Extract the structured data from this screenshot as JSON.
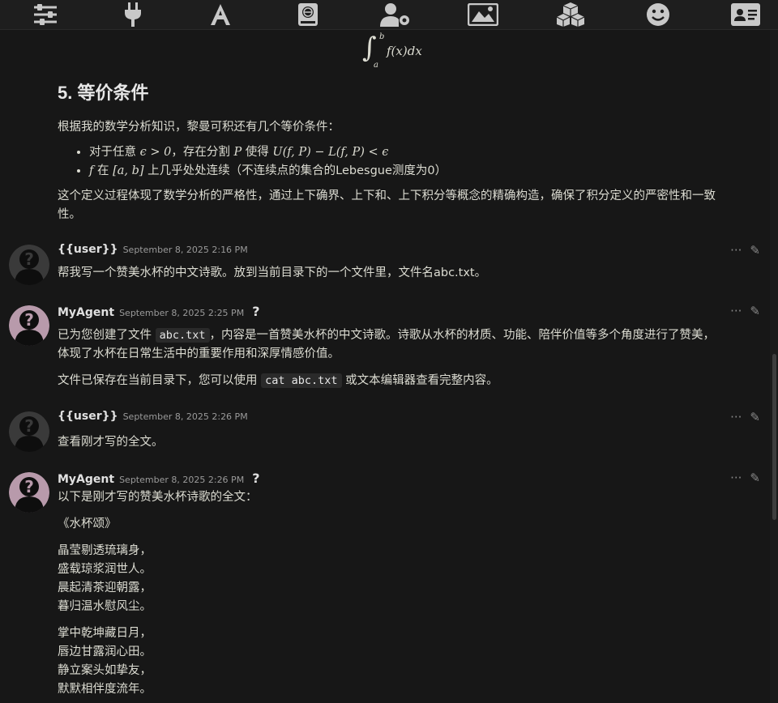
{
  "toolbar": {
    "icons": [
      "sliders-icon",
      "plug-icon",
      "font-icon",
      "book-atlas-icon",
      "user-gear-icon",
      "image-icon",
      "cubes-icon",
      "smile-icon",
      "id-card-icon"
    ]
  },
  "math_block": {
    "integral_upper": "b",
    "integral_lower": "a",
    "integrand": "f(x)dx"
  },
  "section": {
    "heading": "5. 等价条件",
    "intro": "根据我的数学分析知识，黎曼可积还有几个等价条件：",
    "cond1_prefix": "对于任意 ",
    "cond1_math1": "ϵ > 0",
    "cond1_mid": "，存在分割 ",
    "cond1_math2": "P",
    "cond1_mid2": " 使得 ",
    "cond1_math3": "U(f, P) − L(f, P) < ϵ",
    "cond2_math1": "f",
    "cond2_mid": " 在 ",
    "cond2_math2": "[a, b]",
    "cond2_text": " 上几乎处处连续（不连续点的集合的Lebesgue测度为0）",
    "conclusion": "这个定义过程体现了数学分析的严格性，通过上下确界、上下和、上下积分等概念的精确构造，确保了积分定义的严密性和一致性。"
  },
  "messages": [
    {
      "sender": "{{user}}",
      "time": "September 8, 2025 2:16 PM",
      "text": "帮我写一个赞美水杯的中文诗歌。放到当前目录下的一个文件里，文件名abc.txt。"
    },
    {
      "sender": "MyAgent",
      "time": "September 8, 2025 2:25 PM",
      "qmark": "?",
      "p1_a": "已为您创建了文件 ",
      "p1_code": "abc.txt",
      "p1_b": "，内容是一首赞美水杯的中文诗歌。诗歌从水杯的材质、功能、陪伴价值等多个角度进行了赞美，体现了水杯在日常生活中的重要作用和深厚情感价值。",
      "p2_a": "文件已保存在当前目录下，您可以使用 ",
      "p2_code": "cat abc.txt",
      "p2_b": " 或文本编辑器查看完整内容。"
    },
    {
      "sender": "{{user}}",
      "time": "September 8, 2025 2:26 PM",
      "text": "查看刚才写的全文。"
    },
    {
      "sender": "MyAgent",
      "time": "September 8, 2025 2:26 PM",
      "qmark": "?",
      "intro": "以下是刚才写的赞美水杯诗歌的全文：",
      "title": "《水杯颂》",
      "stanza1": [
        "晶莹剔透琉璃身，",
        "盛载琼浆润世人。",
        "晨起清茶迎朝露，",
        "暮归温水慰风尘。"
      ],
      "stanza2": [
        "掌中乾坤藏日月，",
        "唇边甘露润心田。",
        "静立案头如挚友，",
        "默默相伴度流年。"
      ]
    }
  ],
  "actions": {
    "more": "···",
    "edit": "✎"
  },
  "colors": {
    "background": "#171717",
    "text": "#dcdcd2",
    "toolbar": "#1e1e1e",
    "icon": "#c8c8c8"
  }
}
